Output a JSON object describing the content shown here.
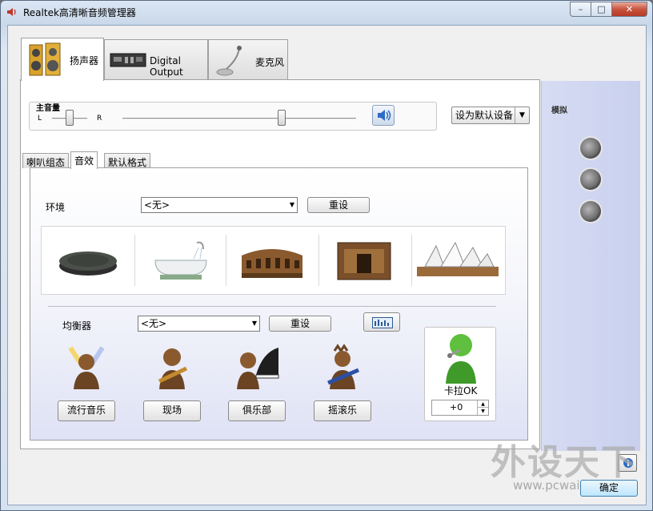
{
  "window": {
    "title": "Realtek高清晰音频管理器",
    "caption": {
      "minimize": "–",
      "maximize": "□",
      "close": "✕"
    }
  },
  "device_tabs": [
    {
      "label": "扬声器",
      "icon": "speakers-icon",
      "active": true
    },
    {
      "label": "Digital Output",
      "icon": "digital-output-icon",
      "active": false
    },
    {
      "label": "麦克风",
      "icon": "microphone-icon",
      "active": false
    }
  ],
  "volume": {
    "group_label": "主音量",
    "left_label": "L",
    "right_label": "R",
    "balance": 0.5,
    "level": 0.68
  },
  "default_device_button": "设为默认设备",
  "sub_tabs": [
    {
      "label": "喇叭组态",
      "active": false
    },
    {
      "label": "音效",
      "active": true
    },
    {
      "label": "默认格式",
      "active": false
    }
  ],
  "environment": {
    "label": "环境",
    "selected": "<无>",
    "reset_label": "重设",
    "presets": [
      "stone-disc",
      "bathtub",
      "colosseum",
      "cave-doorway",
      "opera-house"
    ]
  },
  "equalizer": {
    "label": "均衡器",
    "selected": "<无>",
    "reset_label": "重设",
    "presets": [
      {
        "label": "流行音乐",
        "icon": "pop-singer-icon"
      },
      {
        "label": "现场",
        "icon": "live-guitar-icon"
      },
      {
        "label": "俱乐部",
        "icon": "club-piano-icon"
      },
      {
        "label": "摇滚乐",
        "icon": "rock-guitar-icon"
      }
    ]
  },
  "karaoke": {
    "label": "卡拉OK",
    "value": "+0"
  },
  "right_panel": {
    "title": "模拟",
    "jack_count": 3
  },
  "ok_button": "确定",
  "watermark": {
    "text": "外设天下",
    "url": "www.pcwaishe.cn"
  },
  "colors": {
    "title_bar": "#c9d8ea",
    "right_panel": "#d0d6f0",
    "ok_button": "#bee6fd"
  }
}
